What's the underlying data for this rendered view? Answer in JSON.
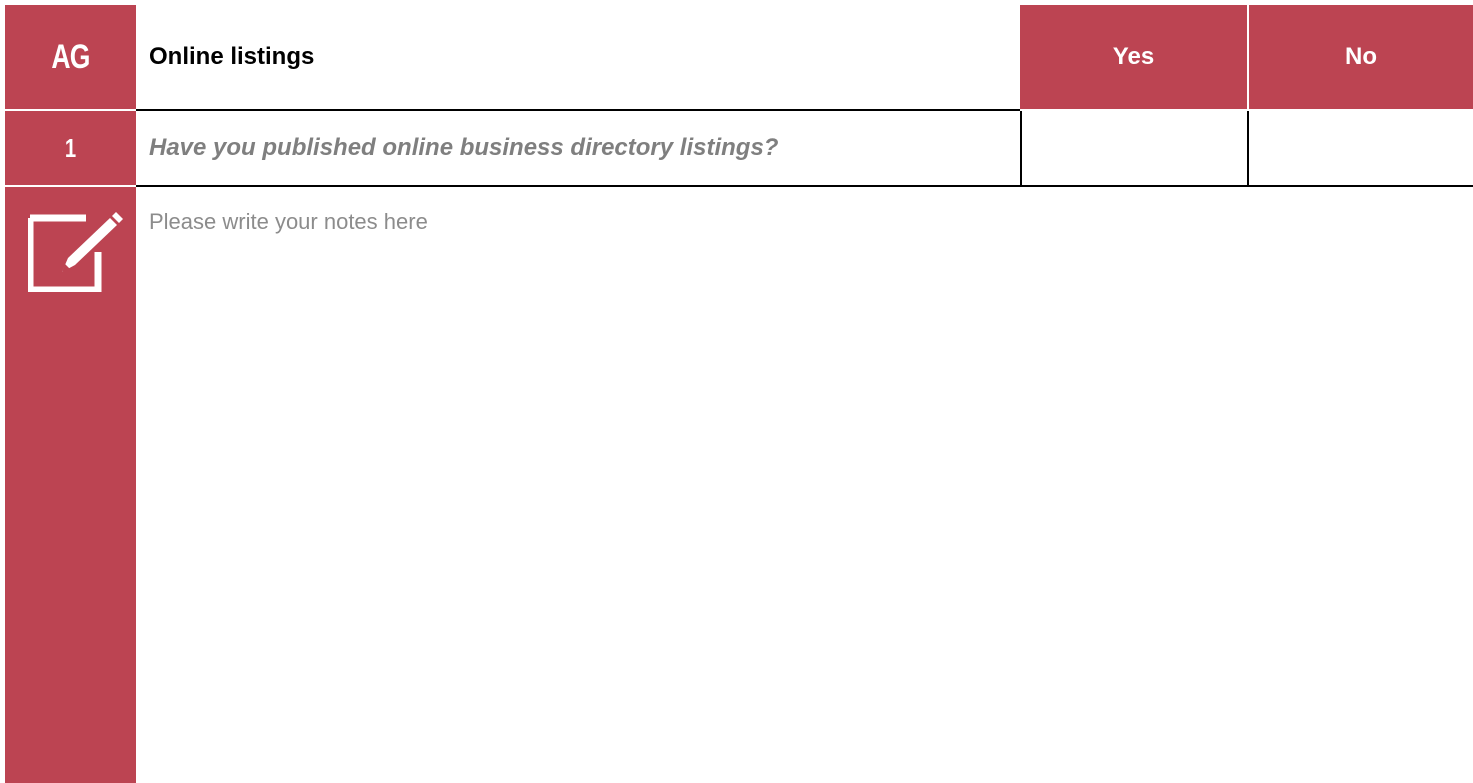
{
  "section": {
    "code": "AG",
    "title": "Online listings",
    "columns": {
      "yes": "Yes",
      "no": "No"
    }
  },
  "question": {
    "number": "1",
    "text": "Have you published online business directory listings?"
  },
  "notes": {
    "icon": "edit-note-icon",
    "placeholder": "Please write your notes here"
  },
  "colors": {
    "accent": "#bc4452",
    "question_text": "#7f7f7f",
    "notes_text": "#8c8c8c"
  }
}
